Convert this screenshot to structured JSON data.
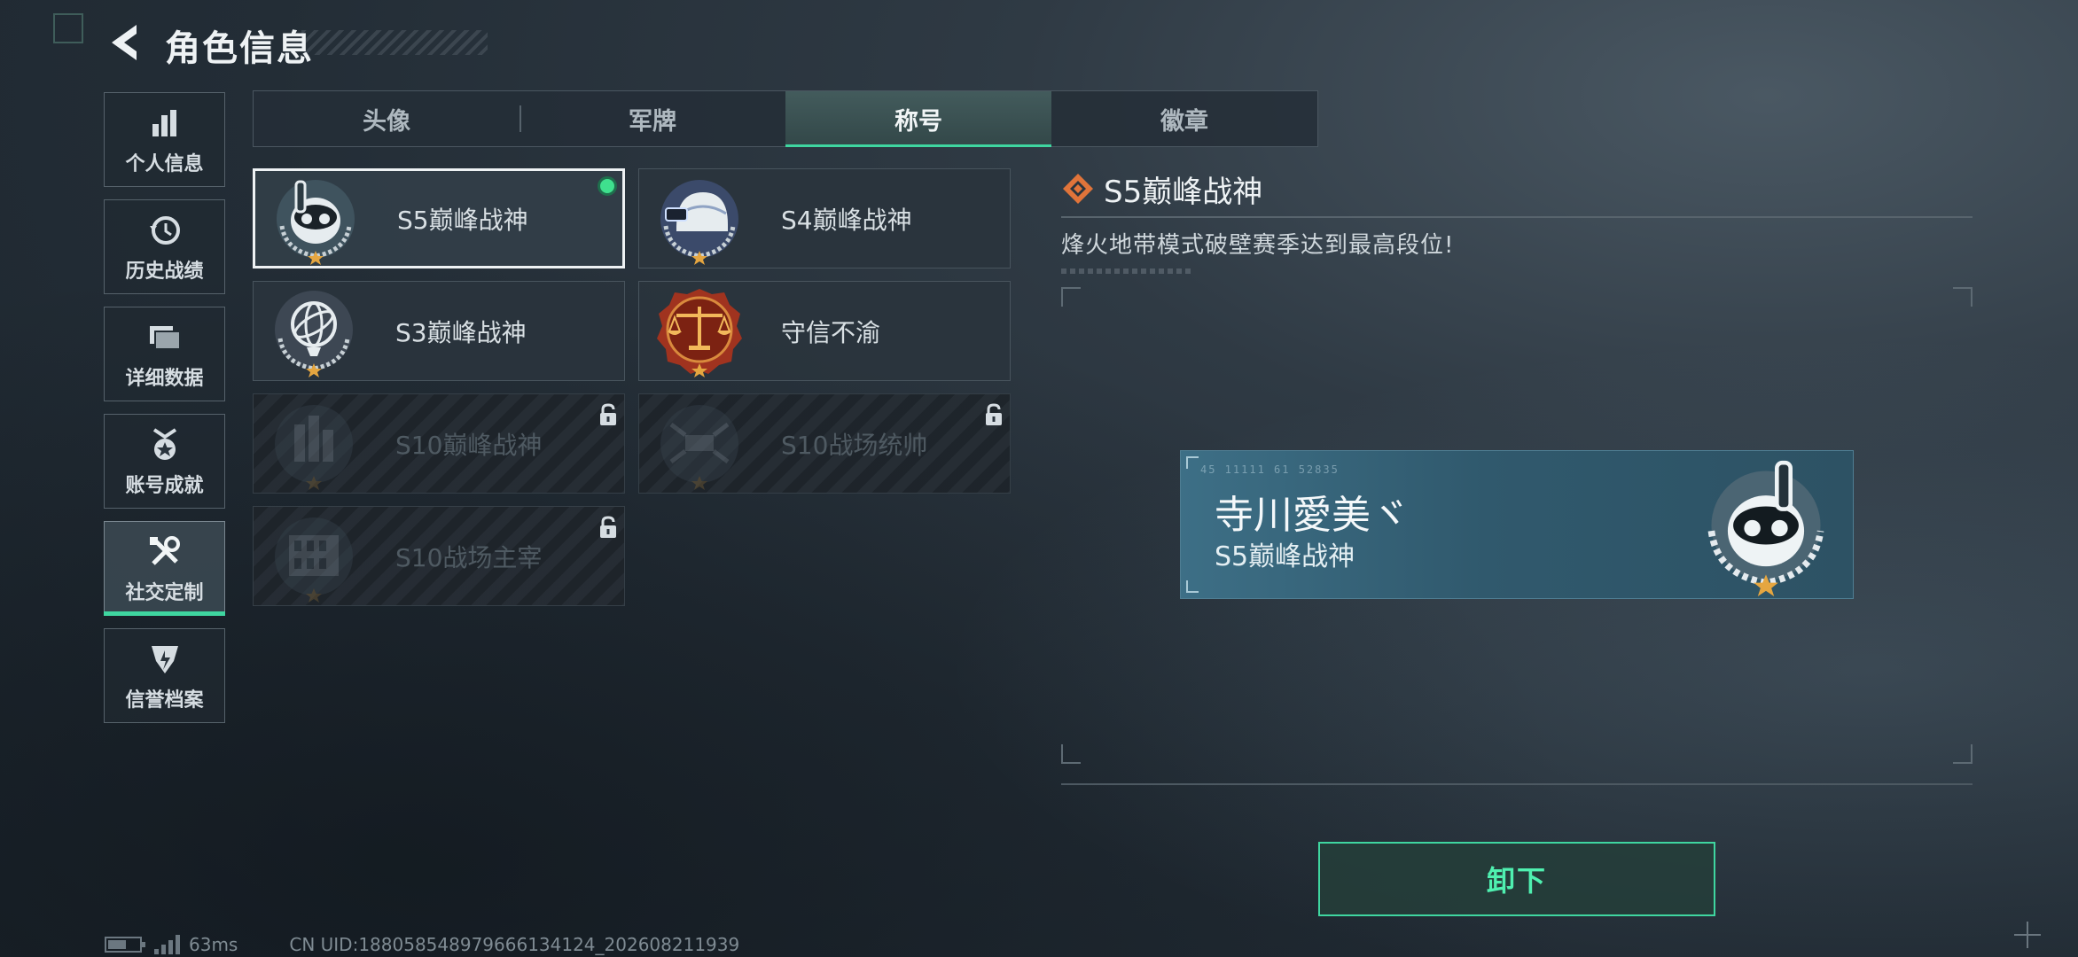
{
  "header": {
    "title": "角色信息"
  },
  "sidebar": {
    "items": [
      {
        "label": "个人信息",
        "icon": "bar-chart-icon"
      },
      {
        "label": "历史战绩",
        "icon": "history-clock-icon"
      },
      {
        "label": "详细数据",
        "icon": "folders-icon"
      },
      {
        "label": "账号成就",
        "icon": "achievement-medal-icon"
      },
      {
        "label": "社交定制",
        "icon": "tools-icon",
        "active": true
      },
      {
        "label": "信誉档案",
        "icon": "credit-shield-icon"
      }
    ]
  },
  "tabs": [
    {
      "label": "头像"
    },
    {
      "label": "军牌"
    },
    {
      "label": "称号",
      "active": true
    },
    {
      "label": "徽章"
    }
  ],
  "titles": [
    {
      "name": "S5巅峰战神",
      "emblem": "diver-skull-emblem",
      "selected": true,
      "equipped": true
    },
    {
      "name": "S4巅峰战神",
      "emblem": "helmet-emblem"
    },
    {
      "name": "S3巅峰战神",
      "emblem": "armillary-emblem"
    },
    {
      "name": "守信不渝",
      "emblem": "scales-emblem"
    },
    {
      "name": "S10巅峰战神",
      "emblem": "city-emblem",
      "locked": true
    },
    {
      "name": "S10战场统帅",
      "emblem": "drone-emblem",
      "locked": true
    },
    {
      "name": "S10战场主宰",
      "emblem": "colosseum-emblem",
      "locked": true
    }
  ],
  "detail": {
    "title": "S5巅峰战神",
    "description": "烽火地带模式破壁赛季达到最高段位!"
  },
  "nameplate": {
    "code": "45 11111   61 52835",
    "player_name": "寺川愛美ヾ",
    "title": "S5巅峰战神"
  },
  "actions": {
    "unequip_label": "卸下"
  },
  "footer": {
    "ping": "63ms",
    "uid": "CN UID:1880585489796661341​24_202608211939"
  },
  "colors": {
    "accent": "#3fd6a0",
    "equipped_dot": "#3fe08e",
    "nameplate": "#3d6f86"
  }
}
